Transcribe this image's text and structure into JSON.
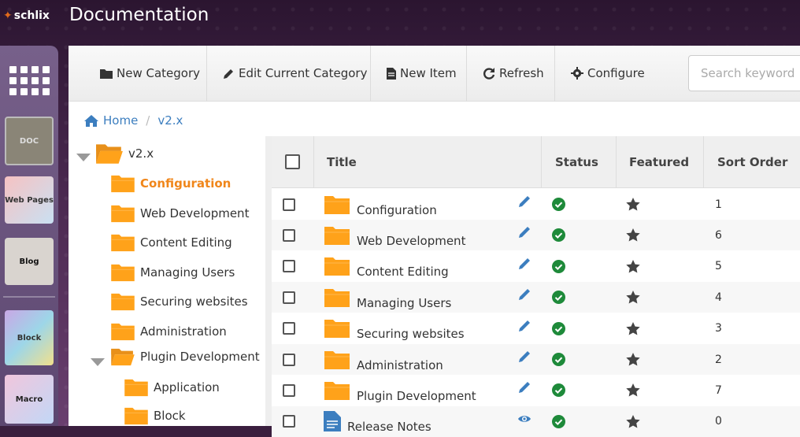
{
  "app": {
    "logo_text": "schlix",
    "title": "Documentation"
  },
  "dock": {
    "items": [
      {
        "name": "apps-grid",
        "label": ""
      },
      {
        "name": "doc",
        "label": "DOC"
      },
      {
        "name": "web-pages",
        "label": "Web Pages"
      },
      {
        "name": "blog",
        "label": "Blog"
      },
      {
        "name": "block",
        "label": "Block"
      },
      {
        "name": "macro",
        "label": "Macro"
      }
    ]
  },
  "toolbar": {
    "new_category": "New Category",
    "edit_category": "Edit Current Category",
    "new_item": "New Item",
    "refresh": "Refresh",
    "configure": "Configure",
    "search_placeholder": "Search keyword"
  },
  "breadcrumb": {
    "home": "Home",
    "current": "v2.x"
  },
  "tree": {
    "root": "v2.x",
    "children": [
      {
        "label": "Configuration",
        "active": true
      },
      {
        "label": "Web Development"
      },
      {
        "label": "Content Editing"
      },
      {
        "label": "Managing Users"
      },
      {
        "label": "Securing websites"
      },
      {
        "label": "Administration"
      },
      {
        "label": "Plugin Development",
        "expanded": true,
        "children": [
          {
            "label": "Application"
          },
          {
            "label": "Block"
          }
        ]
      }
    ]
  },
  "table": {
    "columns": {
      "title": "Title",
      "status": "Status",
      "featured": "Featured",
      "sort_order": "Sort Order"
    },
    "rows": [
      {
        "title": "Configuration",
        "sort": "1"
      },
      {
        "title": "Web Development",
        "sort": "6"
      },
      {
        "title": "Content Editing",
        "sort": "5"
      },
      {
        "title": "Managing Users",
        "sort": "4"
      },
      {
        "title": "Securing websites",
        "sort": "3"
      },
      {
        "title": "Administration",
        "sort": "2"
      },
      {
        "title": "Plugin Development",
        "sort": "7"
      },
      {
        "title": "Release Notes",
        "sort": "0"
      }
    ]
  },
  "colors": {
    "folder": "#ffa21a",
    "accent_orange": "#f0861a",
    "link_blue": "#3c7ebf",
    "status_green": "#1e8a3a"
  }
}
